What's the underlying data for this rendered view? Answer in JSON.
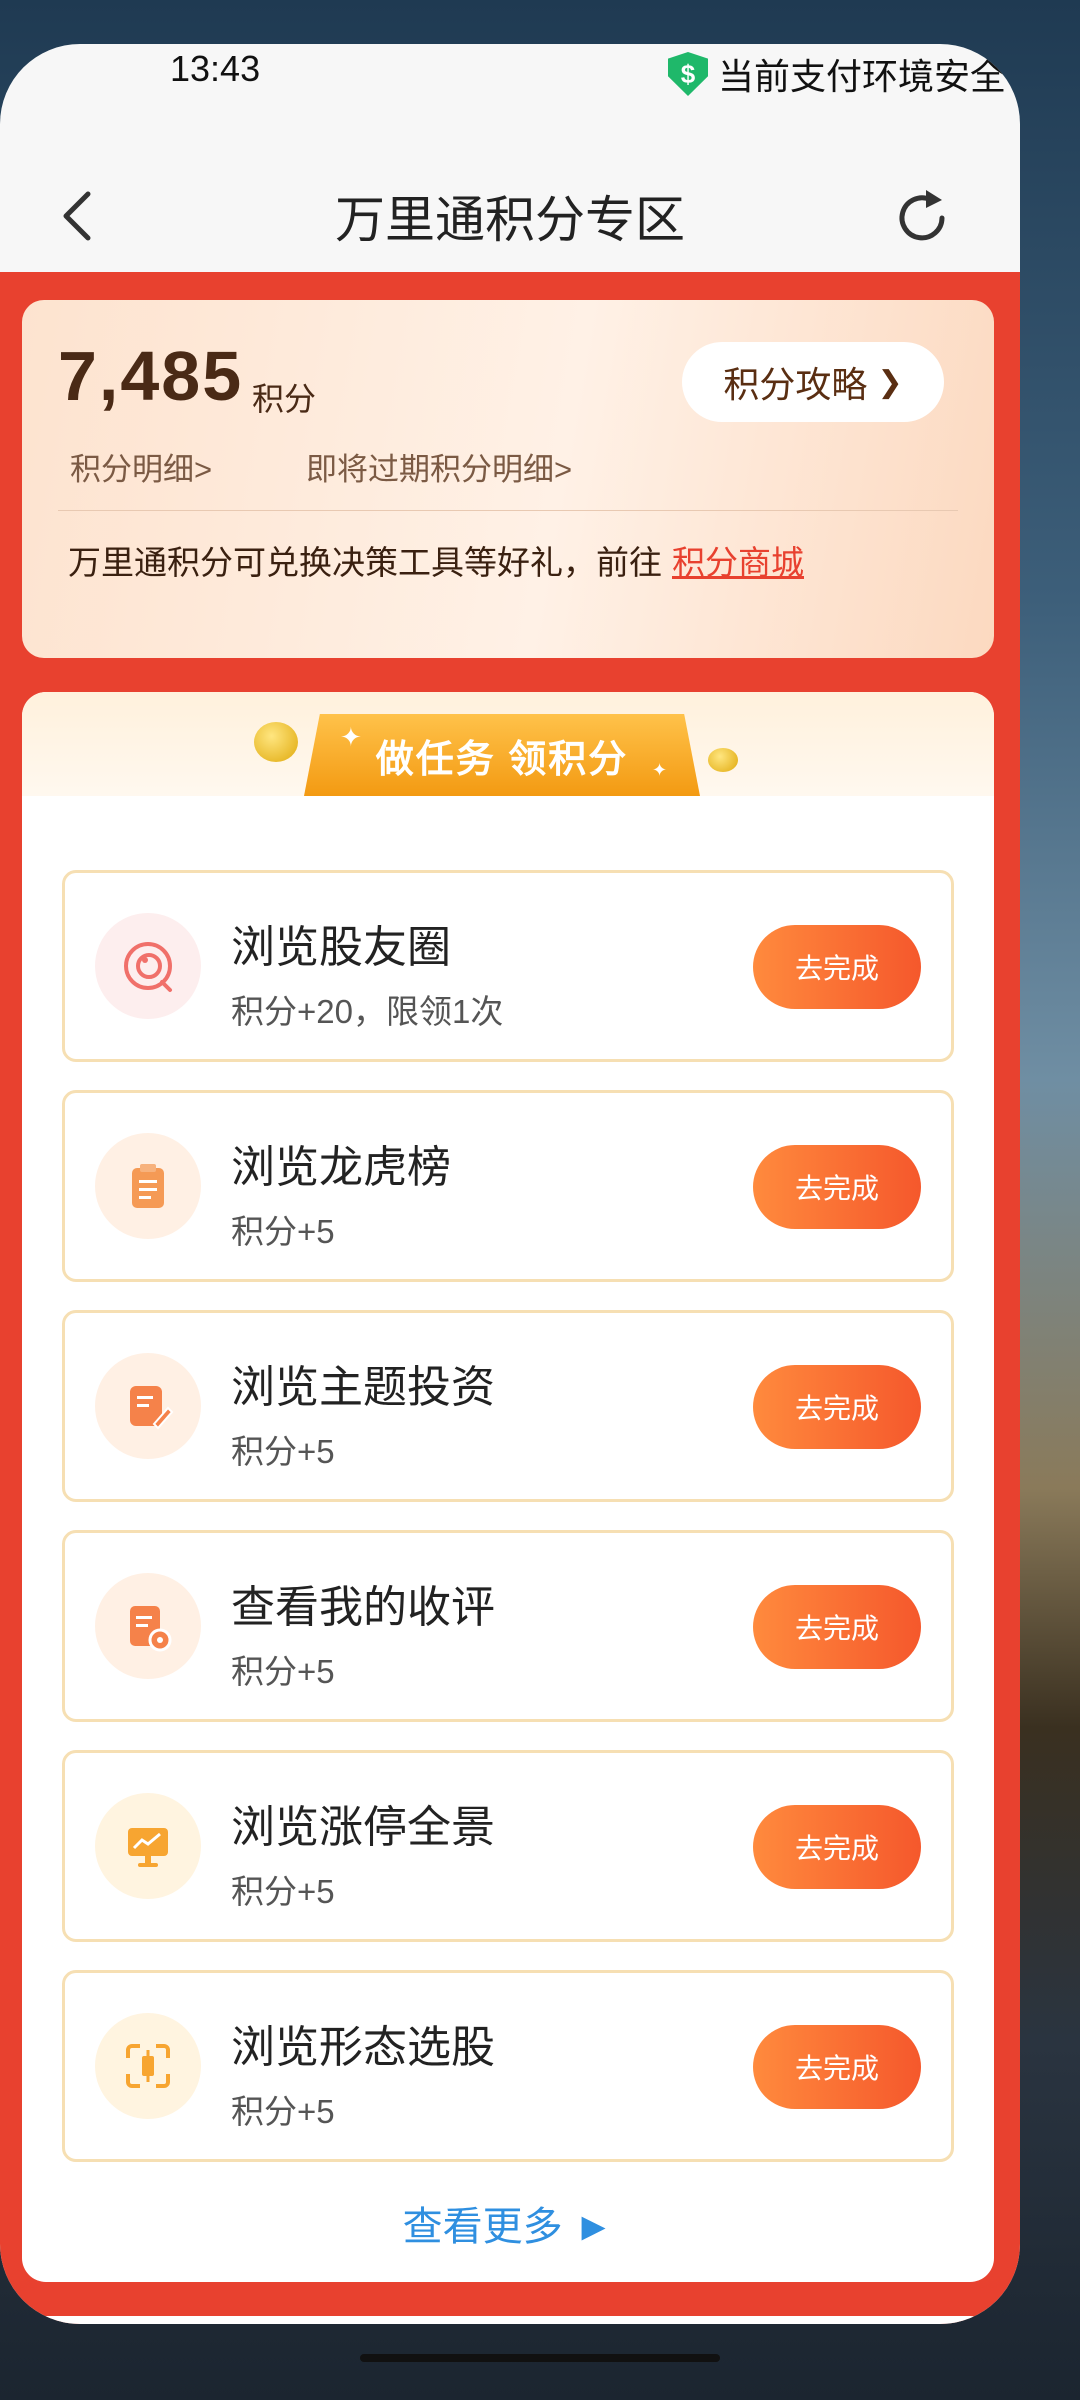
{
  "status_bar": {
    "time": "13:43",
    "pay_secure": "当前支付环境安全",
    "shield_symbol": "$"
  },
  "nav": {
    "title": "万里通积分专区",
    "back_icon": "chevron-left-icon",
    "refresh_icon": "refresh-icon"
  },
  "points_card": {
    "value": "7,485",
    "unit": "积分",
    "guide_label": "积分攻略",
    "guide_arrow": "❯",
    "detail_link": "积分明细>",
    "expiring_link": "即将过期积分明细>",
    "exchange_text": "万里通积分可兑换决策工具等好礼，前往",
    "mall_link": "积分商城"
  },
  "task_panel": {
    "banner_text": "做任务 领积分",
    "sparkle": "✦",
    "tasks": [
      {
        "title": "浏览股友圈",
        "reward": "积分+20，限领1次",
        "button": "去完成",
        "icon": "chat-ring-icon",
        "icon_bg": "#fdeeee",
        "icon_color": "#f0706a"
      },
      {
        "title": "浏览龙虎榜",
        "reward": "积分+5",
        "button": "去完成",
        "icon": "clipboard-icon",
        "icon_bg": "#fff0e4",
        "icon_color": "#f59a55"
      },
      {
        "title": "浏览主题投资",
        "reward": "积分+5",
        "button": "去完成",
        "icon": "edit-doc-icon",
        "icon_bg": "#fff0e4",
        "icon_color": "#f5824a"
      },
      {
        "title": "查看我的收评",
        "reward": "积分+5",
        "button": "去完成",
        "icon": "review-doc-icon",
        "icon_bg": "#fff0e4",
        "icon_color": "#f5824a"
      },
      {
        "title": "浏览涨停全景",
        "reward": "积分+5",
        "button": "去完成",
        "icon": "chart-monitor-icon",
        "icon_bg": "#fff4e0",
        "icon_color": "#f7a531"
      },
      {
        "title": "浏览形态选股",
        "reward": "积分+5",
        "button": "去完成",
        "icon": "scan-frame-icon",
        "icon_bg": "#fff4e0",
        "icon_color": "#f7a531"
      }
    ],
    "more_label": "查看更多 ►"
  },
  "colors": {
    "accent_red": "#e8412f",
    "button_orange": "#f5582c",
    "link_blue": "#2f8fe0",
    "secure_green": "#1fb86a"
  }
}
